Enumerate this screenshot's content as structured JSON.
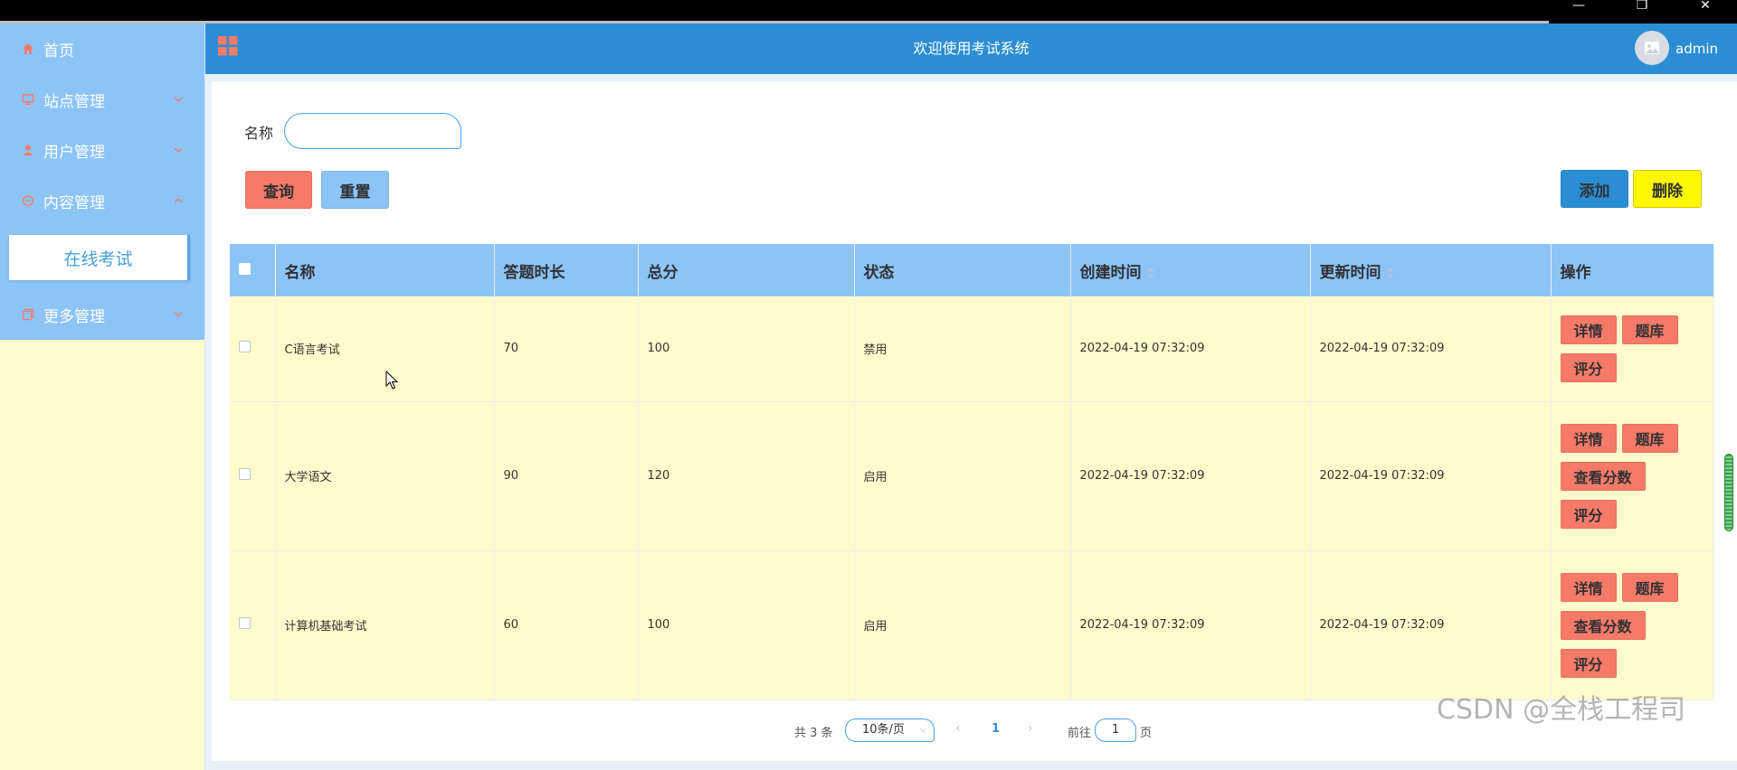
{
  "window": {
    "minimize": "—",
    "maximize": "❐",
    "close": "✕"
  },
  "header": {
    "title": "欢迎使用考试系统",
    "username": "admin"
  },
  "sidebar": {
    "items": [
      {
        "label": "首页"
      },
      {
        "label": "站点管理"
      },
      {
        "label": "用户管理"
      },
      {
        "label": "内容管理"
      },
      {
        "label": "更多管理"
      }
    ],
    "active_sub": "在线考试"
  },
  "search": {
    "label": "名称",
    "value": ""
  },
  "toolbar": {
    "query": "查询",
    "reset": "重置",
    "add": "添加",
    "delete": "删除"
  },
  "table": {
    "columns": [
      "名称",
      "答题时长",
      "总分",
      "状态",
      "创建时间",
      "更新时间",
      "操作"
    ],
    "rows": [
      {
        "name": "C语言考试",
        "duration": "70",
        "score": "100",
        "status": "禁用",
        "created": "2022-04-19 07:32:09",
        "updated": "2022-04-19 07:32:09",
        "ops": [
          "详情",
          "题库",
          "评分"
        ]
      },
      {
        "name": "大学语文",
        "duration": "90",
        "score": "120",
        "status": "启用",
        "created": "2022-04-19 07:32:09",
        "updated": "2022-04-19 07:32:09",
        "ops": [
          "详情",
          "题库",
          "查看分数",
          "评分"
        ]
      },
      {
        "name": "计算机基础考试",
        "duration": "60",
        "score": "100",
        "status": "启用",
        "created": "2022-04-19 07:32:09",
        "updated": "2022-04-19 07:32:09",
        "ops": [
          "详情",
          "题库",
          "查看分数",
          "评分"
        ]
      }
    ]
  },
  "pager": {
    "total": "共 3 条",
    "page_size": "10条/页",
    "current": "1",
    "goto_prefix": "前往",
    "goto_value": "1",
    "goto_suffix": "页"
  },
  "watermark": "CSDN @全栈工程司",
  "colors": {
    "header": "#2b8ed4",
    "sidebar": "#8cc4f8",
    "page_bg": "#fffbcc",
    "danger": "#f67a68",
    "warning": "#fff700"
  }
}
